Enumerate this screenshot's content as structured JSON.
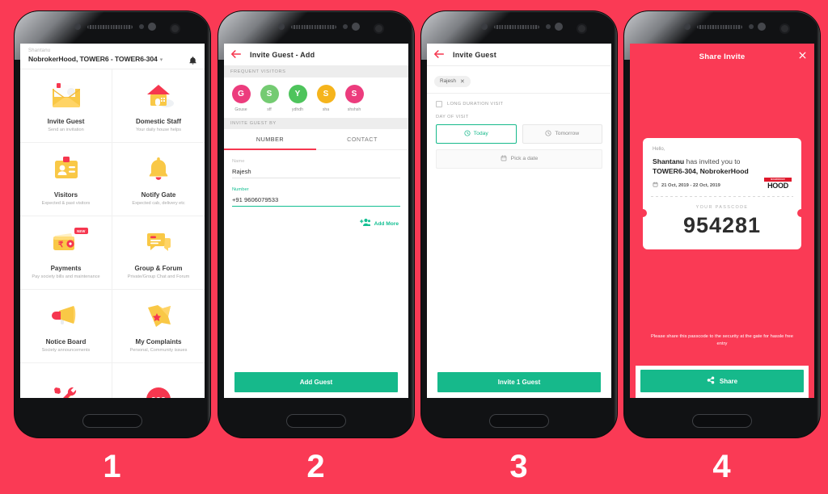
{
  "background_color": "#FA3A55",
  "accent_teal": "#16B98B",
  "accent_pink": "#F6374F",
  "steps": [
    "1",
    "2",
    "3",
    "4"
  ],
  "phone1": {
    "header": {
      "user": "Shantanu",
      "address": "NobrokerHood, TOWER6 - TOWER6-304",
      "chevron": "⌄",
      "bell_icon": "bell-icon"
    },
    "tiles": [
      {
        "title": "Invite Guest",
        "subtitle": "Send an invitation",
        "icon": "envelope-icon"
      },
      {
        "title": "Domestic Staff",
        "subtitle": "Your daily house helps",
        "icon": "house-icon"
      },
      {
        "title": "Visitors",
        "subtitle": "Expected & past visitors",
        "icon": "id-card-icon"
      },
      {
        "title": "Notify Gate",
        "subtitle": "Expected cab, delivery etc",
        "icon": "bell-icon"
      },
      {
        "title": "Payments",
        "subtitle": "Pay society bills and maintenance",
        "icon": "wallet-icon",
        "badge": "NEW"
      },
      {
        "title": "Group & Forum",
        "subtitle": "Private/Group Chat and Forum",
        "icon": "chat-icon"
      },
      {
        "title": "Notice Board",
        "subtitle": "Society announcements",
        "icon": "megaphone-icon"
      },
      {
        "title": "My Complaints",
        "subtitle": "Personal, Community issues",
        "icon": "flag-icon"
      },
      {
        "title": "",
        "subtitle": "",
        "icon": "tools-icon"
      },
      {
        "title": "",
        "subtitle": "",
        "icon": "sos-button",
        "sos_label": "SOS"
      }
    ]
  },
  "phone2": {
    "appbar_title": "Invite Guest - Add",
    "back_icon": "back-arrow-icon",
    "section_frequent": "FREQUENT VISITORS",
    "visitors": [
      {
        "initial": "G",
        "name": "Gouse",
        "color": "#EC3C7D"
      },
      {
        "initial": "S",
        "name": "sff",
        "color": "#74CB72"
      },
      {
        "initial": "Y",
        "name": "ydhdh",
        "color": "#4EC45C"
      },
      {
        "initial": "S",
        "name": "sha",
        "color": "#F5B41C"
      },
      {
        "initial": "S",
        "name": "shshsh",
        "color": "#EC3C7D"
      }
    ],
    "section_invite_by": "INVITE GUEST BY",
    "tabs": [
      {
        "label": "NUMBER",
        "active": true
      },
      {
        "label": "CONTACT",
        "active": false
      }
    ],
    "name_label": "Name",
    "name_value": "Rajesh",
    "number_label": "Number",
    "number_value": "+91 9606079533",
    "add_more_label": "Add More",
    "add_more_icon": "add-people-icon",
    "cta_label": "Add Guest"
  },
  "phone3": {
    "appbar_title": "Invite Guest",
    "back_icon": "back-arrow-icon",
    "chip_label": "Rajesh",
    "chip_close_icon": "close-icon",
    "long_duration_label": "LONG DURATION VISIT",
    "day_of_visit_label": "DAY OF VISIT",
    "day_buttons": [
      {
        "label": "Today",
        "icon": "clock-icon",
        "selected": true
      },
      {
        "label": "Tomorrow",
        "icon": "clock-icon",
        "selected": false
      }
    ],
    "pick_date_label": "Pick a date",
    "pick_date_icon": "calendar-icon",
    "cta_label": "Invite 1 Guest"
  },
  "phone4": {
    "title": "Share Invite",
    "close_icon": "close-icon",
    "hello": "Hello,",
    "inviter": "Shantanu",
    "invite_text_1": " has invited you to",
    "invite_text_2": "TOWER6-304, NobrokerHood",
    "date_range": "21 Oct, 2019 - 22 Oct, 2019",
    "date_icon": "calendar-icon",
    "logo_top": "NOBROKER",
    "logo_word": "HOOD",
    "passcode_label": "YOUR PASSCODE",
    "passcode": "954281",
    "note": "Please share this passcode to the security at the gate for hassle free entry",
    "cta_label": "Share",
    "cta_icon": "share-icon"
  }
}
